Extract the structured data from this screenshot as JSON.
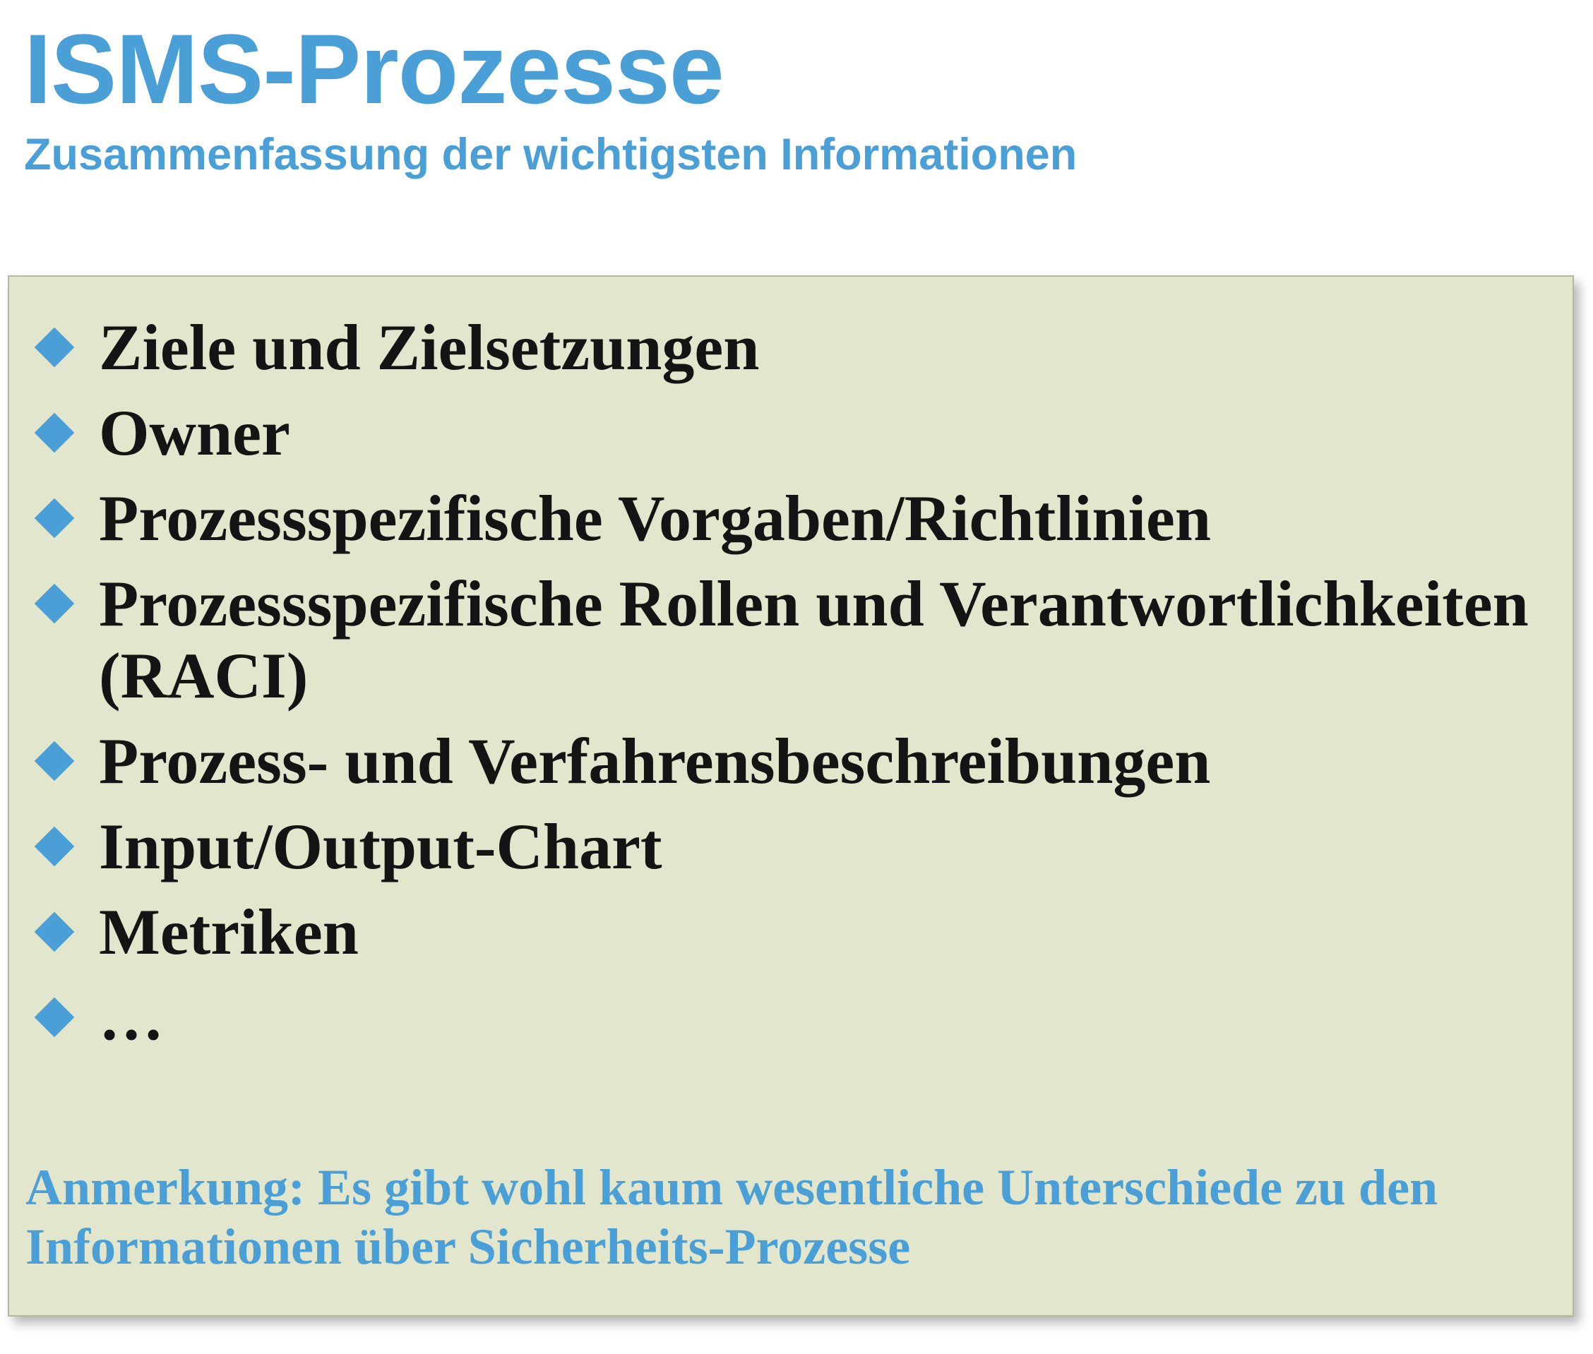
{
  "header": {
    "title": "ISMS-Prozesse",
    "subtitle": "Zusammenfassung der wichtigsten Informationen"
  },
  "panel": {
    "bullet_icon": "diamond-bullet-icon",
    "items": [
      {
        "label": "Ziele und Zielsetzungen"
      },
      {
        "label": "Owner"
      },
      {
        "label": "Prozessspezifische Vorgaben/Richtlinien"
      },
      {
        "label": "Prozessspezifische Rollen und Verantwortlichkeiten",
        "label_line2": "(RACI)"
      },
      {
        "label": "Prozess- und Verfahrensbeschreibungen"
      },
      {
        "label": "Input/Output-Chart"
      },
      {
        "label": "Metriken"
      },
      {
        "label": "…"
      }
    ],
    "note": "Anmerkung: Es gibt wohl kaum wesentliche Unterschiede zu den Informationen über Sicherheits-Prozesse"
  },
  "colors": {
    "accent": "#4a9fd6",
    "panel_background": "#e2e6cc",
    "text": "#141414"
  }
}
